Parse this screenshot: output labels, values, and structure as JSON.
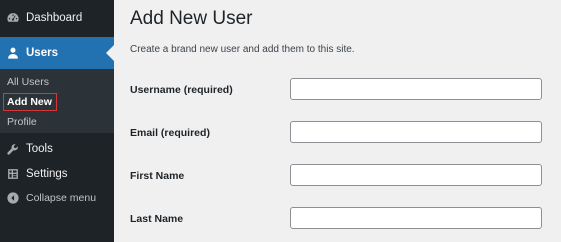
{
  "sidebar": {
    "dashboard": {
      "label": "Dashboard",
      "icon": "dashboard-icon"
    },
    "users": {
      "label": "Users",
      "icon": "users-icon"
    },
    "users_submenu": {
      "all_users": "All Users",
      "add_new": "Add New",
      "profile": "Profile"
    },
    "tools": {
      "label": "Tools",
      "icon": "wrench-icon"
    },
    "settings": {
      "label": "Settings",
      "icon": "settings-icon"
    },
    "collapse": {
      "label": "Collapse menu",
      "icon": "collapse-icon"
    }
  },
  "main": {
    "title": "Add New User",
    "description": "Create a brand new user and add them to this site.",
    "fields": {
      "username": {
        "label": "Username (required)",
        "value": ""
      },
      "email": {
        "label": "Email (required)",
        "value": ""
      },
      "first_name": {
        "label": "First Name",
        "value": ""
      },
      "last_name": {
        "label": "Last Name",
        "value": ""
      }
    }
  },
  "colors": {
    "sidebar_bg": "#1d2327",
    "submenu_bg": "#2c3338",
    "active_menu": "#2271b1",
    "highlight_frame": "#d63638",
    "content_bg": "#f0f0f1"
  }
}
